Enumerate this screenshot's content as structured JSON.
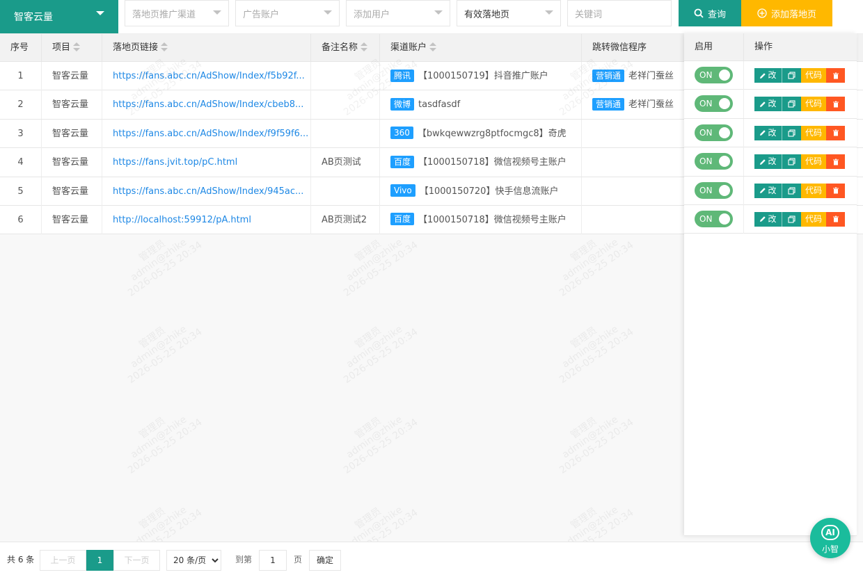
{
  "toolbar": {
    "project_select": "智客云量",
    "channel_placeholder": "落地页推广渠道",
    "account_placeholder": "广告账户",
    "user_placeholder": "添加用户",
    "status_select": "有效落地页",
    "keyword_placeholder": "关键词",
    "query_label": "查询",
    "add_label": "添加落地页"
  },
  "table": {
    "headers": {
      "index": "序号",
      "project": "项目",
      "link": "落地页链接",
      "remark": "备注名称",
      "channel_account": "渠道账户",
      "wechat_mini": "跳转微信程序",
      "enabled": "启用",
      "actions": "操作"
    },
    "rows": [
      {
        "index": "1",
        "project": "智客云量",
        "link": "https://fans.abc.cn/AdShow/Index/f5b92f...",
        "remark": "",
        "channel_tag": "腾讯",
        "channel_account": "【1000150719】抖音推广账户",
        "mini_tag": "营销通",
        "mini_name": "老祥门蚕丝",
        "toggle": "ON"
      },
      {
        "index": "2",
        "project": "智客云量",
        "link": "https://fans.abc.cn/AdShow/Index/cbeb8...",
        "remark": "",
        "channel_tag": "微博",
        "channel_account": "tasdfasdf",
        "mini_tag": "营销通",
        "mini_name": "老祥门蚕丝",
        "toggle": "ON"
      },
      {
        "index": "3",
        "project": "智客云量",
        "link": "https://fans.abc.cn/AdShow/Index/f9f59f6...",
        "remark": "",
        "channel_tag": "360",
        "channel_account": "【bwkqewwzrg8ptfocmgc8】奇虎",
        "mini_tag": "",
        "mini_name": "",
        "toggle": "ON"
      },
      {
        "index": "4",
        "project": "智客云量",
        "link": "https://fans.jvit.top/pC.html",
        "remark": "AB页测试",
        "channel_tag": "百度",
        "channel_account": "【1000150718】微信视频号主账户",
        "mini_tag": "",
        "mini_name": "",
        "toggle": "ON"
      },
      {
        "index": "5",
        "project": "智客云量",
        "link": "https://fans.abc.cn/AdShow/Index/945ac...",
        "remark": "",
        "channel_tag": "Vivo",
        "channel_account": "【1000150720】快手信息流账户",
        "mini_tag": "",
        "mini_name": "",
        "toggle": "ON"
      },
      {
        "index": "6",
        "project": "智客云量",
        "link": "http://localhost:59912/pA.html",
        "remark": "AB页测试2",
        "channel_tag": "百度",
        "channel_account": "【1000150718】微信视频号主账户",
        "mini_tag": "",
        "mini_name": "",
        "toggle": "ON"
      }
    ],
    "action_labels": {
      "edit": "改",
      "code": "代码"
    }
  },
  "pager": {
    "total": "共 6 条",
    "prev": "上一页",
    "current": "1",
    "next": "下一页",
    "page_size": "20 条/页",
    "goto_label": "到第",
    "goto_value": "1",
    "page_unit": "页",
    "confirm": "确定"
  },
  "watermark": {
    "line1": "管理员",
    "line2": "admin@zhike",
    "line3": "2026-05-25 20:34"
  },
  "ai_assistant": {
    "icon_text": "AI",
    "label": "小智"
  },
  "colors": {
    "primary": "#1a9b8a",
    "warning": "#ffb800",
    "danger": "#ff5722",
    "link": "#1e88e5",
    "tag": "#1e9fff",
    "switch_on": "#5fb878"
  }
}
